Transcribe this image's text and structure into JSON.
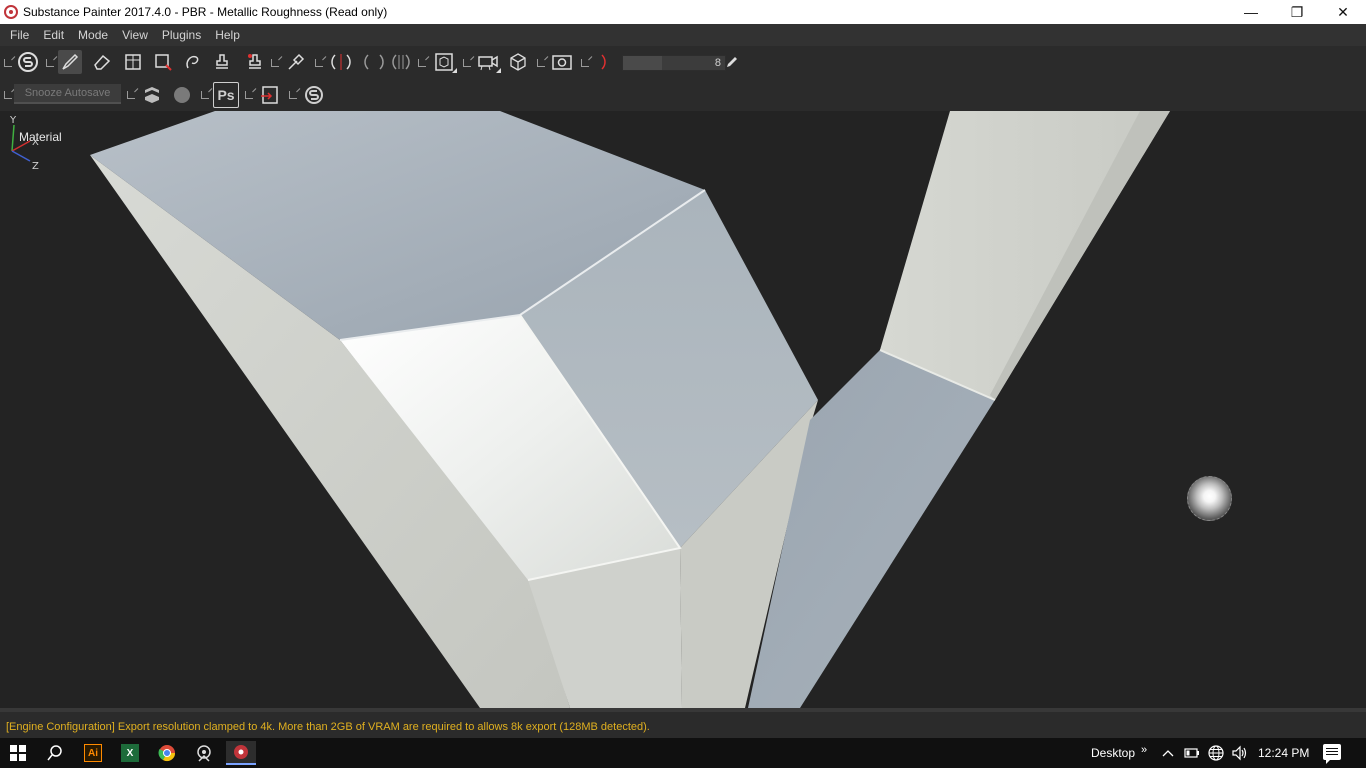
{
  "window": {
    "title": "Substance Painter 2017.4.0 - PBR - Metallic Roughness (Read only)",
    "controls": {
      "minimize": "—",
      "maximize": "❐",
      "close": "✕"
    }
  },
  "menu": [
    "File",
    "Edit",
    "Mode",
    "View",
    "Plugins",
    "Help"
  ],
  "toolbar": {
    "brush_size_value": "8",
    "brush_size_fraction": 0.38,
    "snooze_autosave_label": "Snooze Autosave",
    "photoshop_label": "Ps"
  },
  "viewport": {
    "channel_label": "Material",
    "axes": {
      "y": "Y",
      "x": "X",
      "z": "Z"
    }
  },
  "status": {
    "message": "[Engine Configuration] Export resolution clamped to 4k. More than 2GB of VRAM are required to allows 8k export (128MB detected).",
    "message_color": "#e0b020"
  },
  "taskbar": {
    "apps": [
      "windows-start",
      "search",
      "illustrator",
      "excel",
      "chrome",
      "app-unknown",
      "substance-painter"
    ],
    "illustrator_label": "Ai",
    "excel_label": "X",
    "desktop_label": "Desktop",
    "chevrons": "»",
    "clock": "12:24 PM"
  },
  "colors": {
    "accent_red": "#c0343a",
    "viewport_bg": "#232323",
    "toolbar_bg": "#2b2b2b",
    "menubar_bg": "#323232"
  }
}
